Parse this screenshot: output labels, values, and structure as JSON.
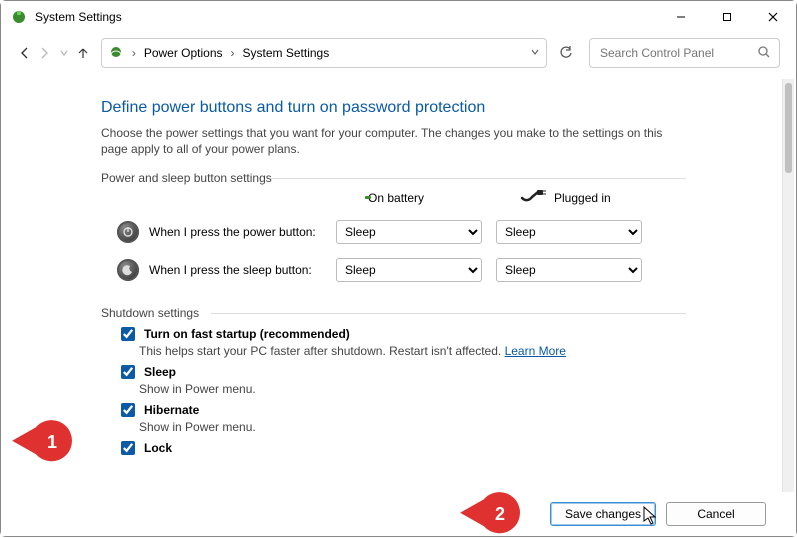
{
  "window": {
    "title": "System Settings"
  },
  "breadcrumb": {
    "root": "Power Options",
    "current": "System Settings"
  },
  "search": {
    "placeholder": "Search Control Panel"
  },
  "page": {
    "heading": "Define power buttons and turn on password protection",
    "description": "Choose the power settings that you want for your computer. The changes you make to the settings on this page apply to all of your power plans."
  },
  "power_sleep": {
    "group_label": "Power and sleep button settings",
    "battery_label": "On battery",
    "plugged_label": "Plugged in",
    "rows": [
      {
        "label": "When I press the power button:",
        "battery": "Sleep",
        "plugged": "Sleep"
      },
      {
        "label": "When I press the sleep button:",
        "battery": "Sleep",
        "plugged": "Sleep"
      }
    ]
  },
  "shutdown": {
    "group_label": "Shutdown settings",
    "items": [
      {
        "title": "Turn on fast startup (recommended)",
        "desc_pre": "This helps start your PC faster after shutdown. Restart isn't affected. ",
        "link": "Learn More",
        "checked": true
      },
      {
        "title": "Sleep",
        "desc_pre": "Show in Power menu.",
        "link": "",
        "checked": true
      },
      {
        "title": "Hibernate",
        "desc_pre": "Show in Power menu.",
        "link": "",
        "checked": true
      },
      {
        "title": "Lock",
        "desc_pre": "",
        "link": "",
        "checked": true
      }
    ]
  },
  "footer": {
    "save": "Save changes",
    "cancel": "Cancel"
  },
  "annotations": {
    "one": "1",
    "two": "2"
  }
}
